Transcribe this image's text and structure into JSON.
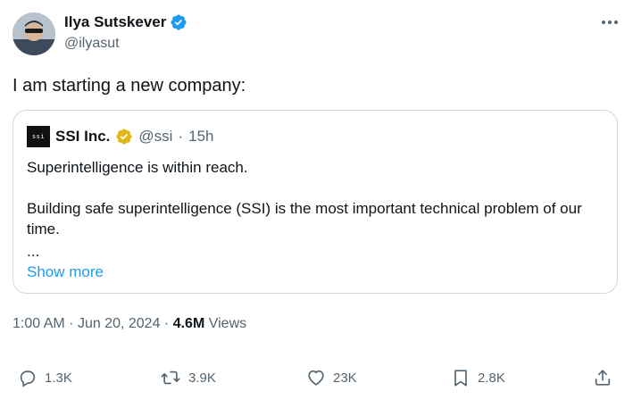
{
  "author": {
    "name": "Ilya Sutskever",
    "handle": "@ilyasut",
    "verified_color": "#1d9bf0"
  },
  "tweet": {
    "text": "I am starting a new company:"
  },
  "quote": {
    "logo_text": "ssi",
    "name": "SSI Inc.",
    "verified_color": "#f4c430",
    "handle": "@ssi",
    "time": "15h",
    "separator": "·",
    "line1": "Superintelligence is within reach.",
    "line2": "Building safe superintelligence (SSI) is the most important technical problem of our time.",
    "ellipsis": "...",
    "show_more": "Show more"
  },
  "meta": {
    "time": "1:00 AM",
    "date": "Jun 20, 2024",
    "separator": "·",
    "views_count": "4.6M",
    "views_label": "Views"
  },
  "actions": {
    "replies": "1.3K",
    "reposts": "3.9K",
    "likes": "23K",
    "bookmarks": "2.8K"
  },
  "colors": {
    "accent": "#1d9bf0",
    "text": "#0f1419",
    "muted": "#536471",
    "border": "#cfd9de"
  }
}
